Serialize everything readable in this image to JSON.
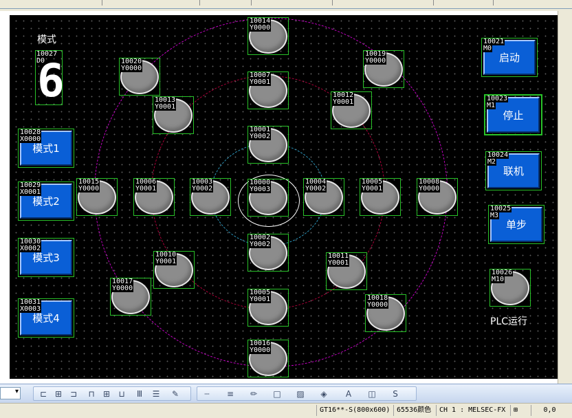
{
  "panel": {
    "mode_label": "模式",
    "plc_label": "PLC运行",
    "digit": {
      "id": "10027",
      "dev": "D0",
      "value": "6"
    }
  },
  "lamps": [
    {
      "id": "10014",
      "dev": "Y0000"
    },
    {
      "id": "10007",
      "dev": "Y0001"
    },
    {
      "id": "10001",
      "dev": "Y0002"
    },
    {
      "id": "10000",
      "dev": "Y0003"
    },
    {
      "id": "10002",
      "dev": "Y0002"
    },
    {
      "id": "10005",
      "dev": "Y0001"
    },
    {
      "id": "10016",
      "dev": "Y0000"
    },
    {
      "id": "10015",
      "dev": "Y0000"
    },
    {
      "id": "10006",
      "dev": "Y0001"
    },
    {
      "id": "10003",
      "dev": "Y0002"
    },
    {
      "id": "10004",
      "dev": "Y0002"
    },
    {
      "id": "10005",
      "dev": "Y0001"
    },
    {
      "id": "10008",
      "dev": "Y0000"
    },
    {
      "id": "10020",
      "dev": "Y0000"
    },
    {
      "id": "10013",
      "dev": "Y0001"
    },
    {
      "id": "10019",
      "dev": "Y0000"
    },
    {
      "id": "10012",
      "dev": "Y0001"
    },
    {
      "id": "10017",
      "dev": "Y0000"
    },
    {
      "id": "10010",
      "dev": "Y0001"
    },
    {
      "id": "10011",
      "dev": "Y0001"
    },
    {
      "id": "10018",
      "dev": "Y0000"
    },
    {
      "id": "10026",
      "dev": "M10"
    }
  ],
  "left_buttons": [
    {
      "id": "10028",
      "dev": "X0000",
      "label": "模式1"
    },
    {
      "id": "10029",
      "dev": "X0001",
      "label": "模式2"
    },
    {
      "id": "10030",
      "dev": "X0002",
      "label": "模式3"
    },
    {
      "id": "10031",
      "dev": "X0003",
      "label": "模式4"
    }
  ],
  "right_buttons": [
    {
      "id": "10021",
      "dev": "M0",
      "label": "启动"
    },
    {
      "id": "10023",
      "dev": "M1",
      "label": "停止"
    },
    {
      "id": "10024",
      "dev": "M2",
      "label": "联机"
    },
    {
      "id": "10025",
      "dev": "M3",
      "label": "单步"
    }
  ],
  "colors": {
    "ring_outer": "#c800c8",
    "ring_middle": "#b4003c",
    "ring_inner": "#2fa0c8",
    "frame": "#29c329",
    "button_face": "#0a5fd6"
  },
  "status": {
    "model": "GT16**-S(800x600)",
    "colors": "65536颜色",
    "channel": "CH 1 : MELSEC-FX",
    "coords": "0,0"
  }
}
